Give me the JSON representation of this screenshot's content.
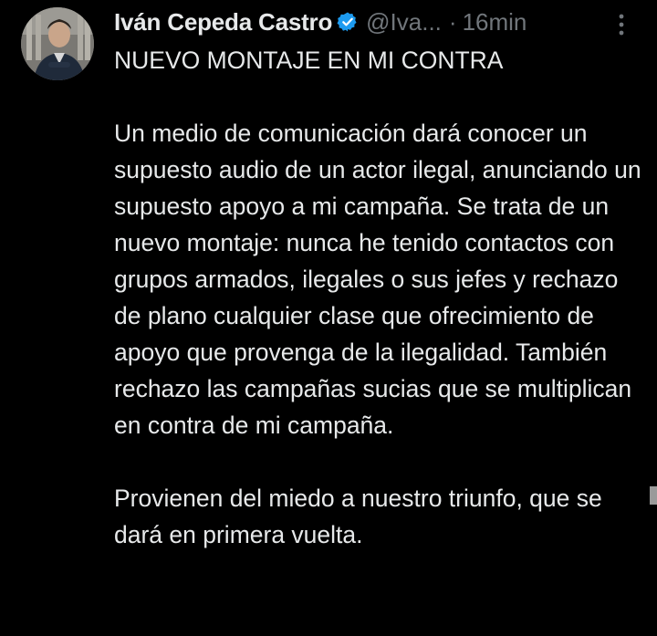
{
  "tweet": {
    "display_name": "Iván Cepeda Castro",
    "handle": "@Iva...",
    "separator": "·",
    "time": "16min",
    "verified": true,
    "icons": {
      "verified": "verified-badge-icon",
      "more": "more-options-icon"
    },
    "colors": {
      "background": "#000000",
      "text": "#e7e9ea",
      "secondary": "#71767b",
      "verified_blue": "#1d9bf0"
    },
    "paragraphs": [
      "NUEVO MONTAJE EN MI CONTRA",
      "Un medio de comunicación dará conocer un supuesto audio de un actor ilegal, anunciando un supuesto apoyo a mi campaña. Se trata de un nuevo montaje: nunca he tenido contactos con grupos armados, ilegales o sus jefes y rechazo de plano cualquier clase que ofrecimiento de apoyo que provenga de la ilegalidad. También rechazo las campañas sucias que se multiplican en contra de mi campaña.",
      "Provienen del miedo a nuestro triunfo, que se dará en primera vuelta."
    ]
  }
}
